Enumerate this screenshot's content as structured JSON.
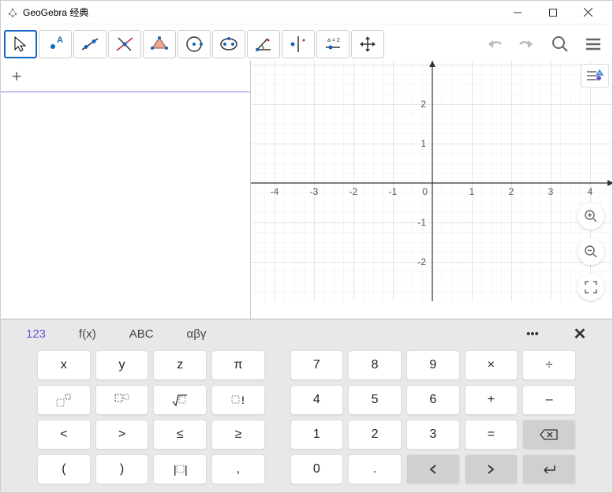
{
  "window": {
    "title": "GeoGebra 经典"
  },
  "toolbar": {
    "tools": [
      {
        "name": "move-tool",
        "selected": true
      },
      {
        "name": "point-tool"
      },
      {
        "name": "line-tool"
      },
      {
        "name": "perpendicular-tool"
      },
      {
        "name": "polygon-tool"
      },
      {
        "name": "circle-tool"
      },
      {
        "name": "ellipse-tool"
      },
      {
        "name": "angle-tool"
      },
      {
        "name": "reflect-tool"
      },
      {
        "name": "slider-tool"
      },
      {
        "name": "move-view-tool"
      }
    ]
  },
  "graphics": {
    "x_ticks": [
      "-4",
      "-3",
      "-2",
      "-1",
      "0",
      "1",
      "2",
      "3",
      "4"
    ],
    "y_ticks": [
      "-2",
      "-1",
      "1",
      "2"
    ]
  },
  "keyboard": {
    "tabs": {
      "t0": "123",
      "t1": "f(x)",
      "t2": "ABC",
      "t3": "αβγ"
    },
    "rows": [
      [
        "x",
        "y",
        "z",
        "π",
        "",
        "7",
        "8",
        "9",
        "×",
        "÷"
      ],
      [
        "^",
        "_",
        "√",
        "!",
        "",
        "4",
        "5",
        "6",
        "+",
        "-"
      ],
      [
        "<",
        ">",
        "≤",
        "≥",
        "",
        "1",
        "2",
        "3",
        "=",
        "⌫"
      ],
      [
        "(",
        ")",
        "|",
        ",",
        "",
        "0",
        ".",
        "◁",
        "▷",
        "↵"
      ]
    ]
  }
}
